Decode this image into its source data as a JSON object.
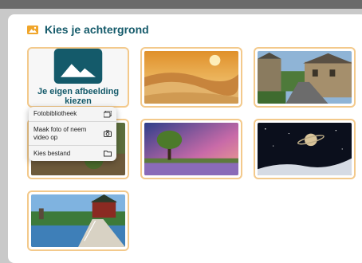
{
  "dialog": {
    "title": "Kies je achtergrond",
    "title_icon": "image-icon"
  },
  "own_image": {
    "label": "Je eigen afbeelding\nkiezen",
    "icon": "image-icon"
  },
  "backgrounds": [
    {
      "name": "desert"
    },
    {
      "name": "village-street"
    },
    {
      "name": "meadow-tree"
    },
    {
      "name": "night-saturn"
    },
    {
      "name": "windmill-bridge"
    }
  ],
  "upload_menu": [
    {
      "label": "Fotobibliotheek",
      "icon": "photo-library-icon"
    },
    {
      "label": "Maak foto of neem video op",
      "icon": "camera-icon"
    },
    {
      "label": "Kies bestand",
      "icon": "folder-icon"
    }
  ],
  "colors": {
    "accent": "#f3c98b",
    "title": "#145a6a"
  }
}
